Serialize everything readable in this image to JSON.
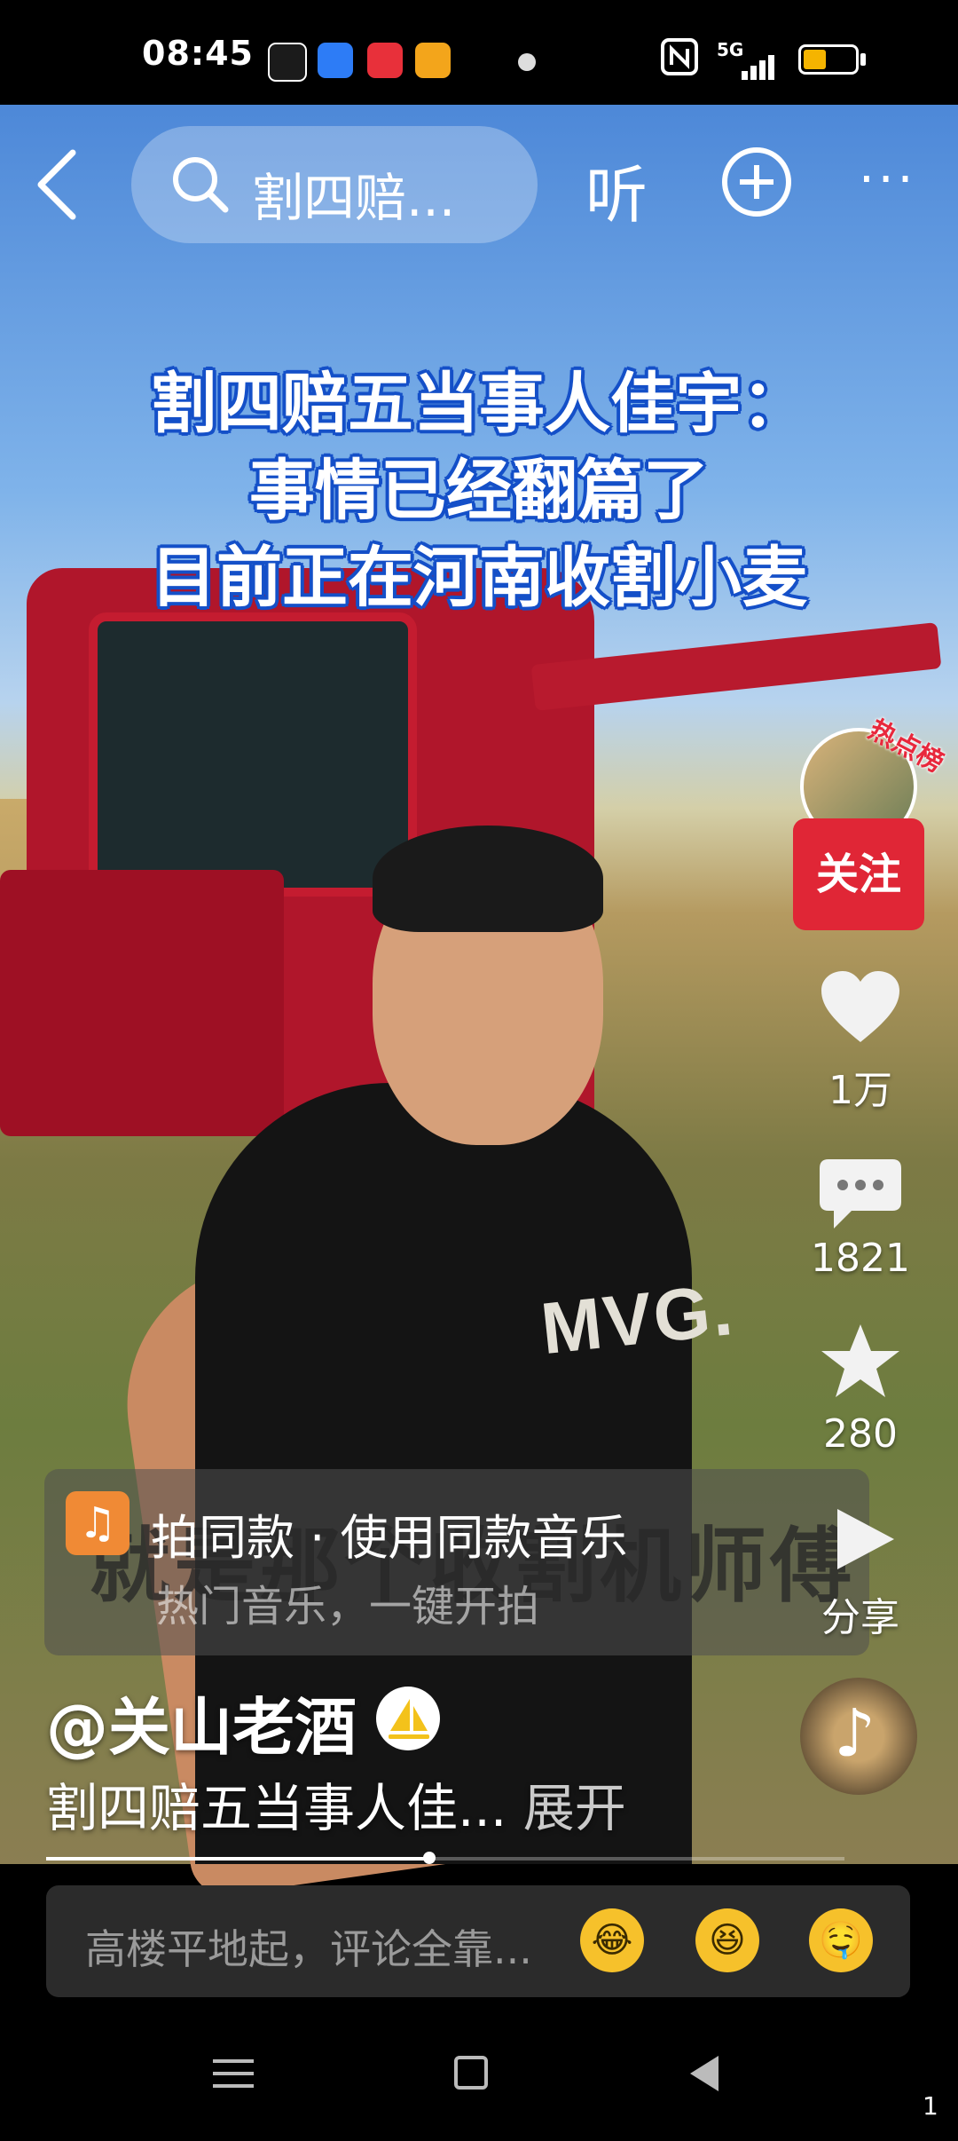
{
  "status_bar": {
    "time": "08:45",
    "network": "5G",
    "battery_level": 0.45,
    "app_icons": [
      "tiktok-icon",
      "browser-icon",
      "shopping-icon",
      "reader-icon"
    ]
  },
  "top_nav": {
    "back_icon": "chevron-left-icon",
    "search_text": "割四赔...",
    "listen_label": "听",
    "add_icon": "plus-circle-icon",
    "more_label": "···"
  },
  "video": {
    "caption_lines": [
      "割四赔五当事人佳宇：",
      "事情已经翻篇了",
      "目前正在河南收割小麦"
    ],
    "shirt_text": "MVG.",
    "subtitle": "就是那个收割机师傅"
  },
  "right_rail": {
    "hot_badge": "热点榜",
    "follow_label": "关注",
    "like_count": "1万",
    "comment_count": "1821",
    "favorite_count": "280",
    "share_label": "分享"
  },
  "music_card": {
    "title": "拍同款 · 使用同款音乐",
    "subtitle": "热门音乐，一键开拍"
  },
  "post": {
    "author": "@关山老酒",
    "description": "割四赔五当事人佳...",
    "expand_label": "展开",
    "progress": 0.48
  },
  "comment_bar": {
    "placeholder": "高楼平地起，评论全靠...",
    "emojis": [
      "😂",
      "😆",
      "🤤"
    ]
  },
  "colors": {
    "follow": "#e02636",
    "caption_outline": "#1550c8",
    "battery": "#f5b400"
  },
  "page_number": "1"
}
